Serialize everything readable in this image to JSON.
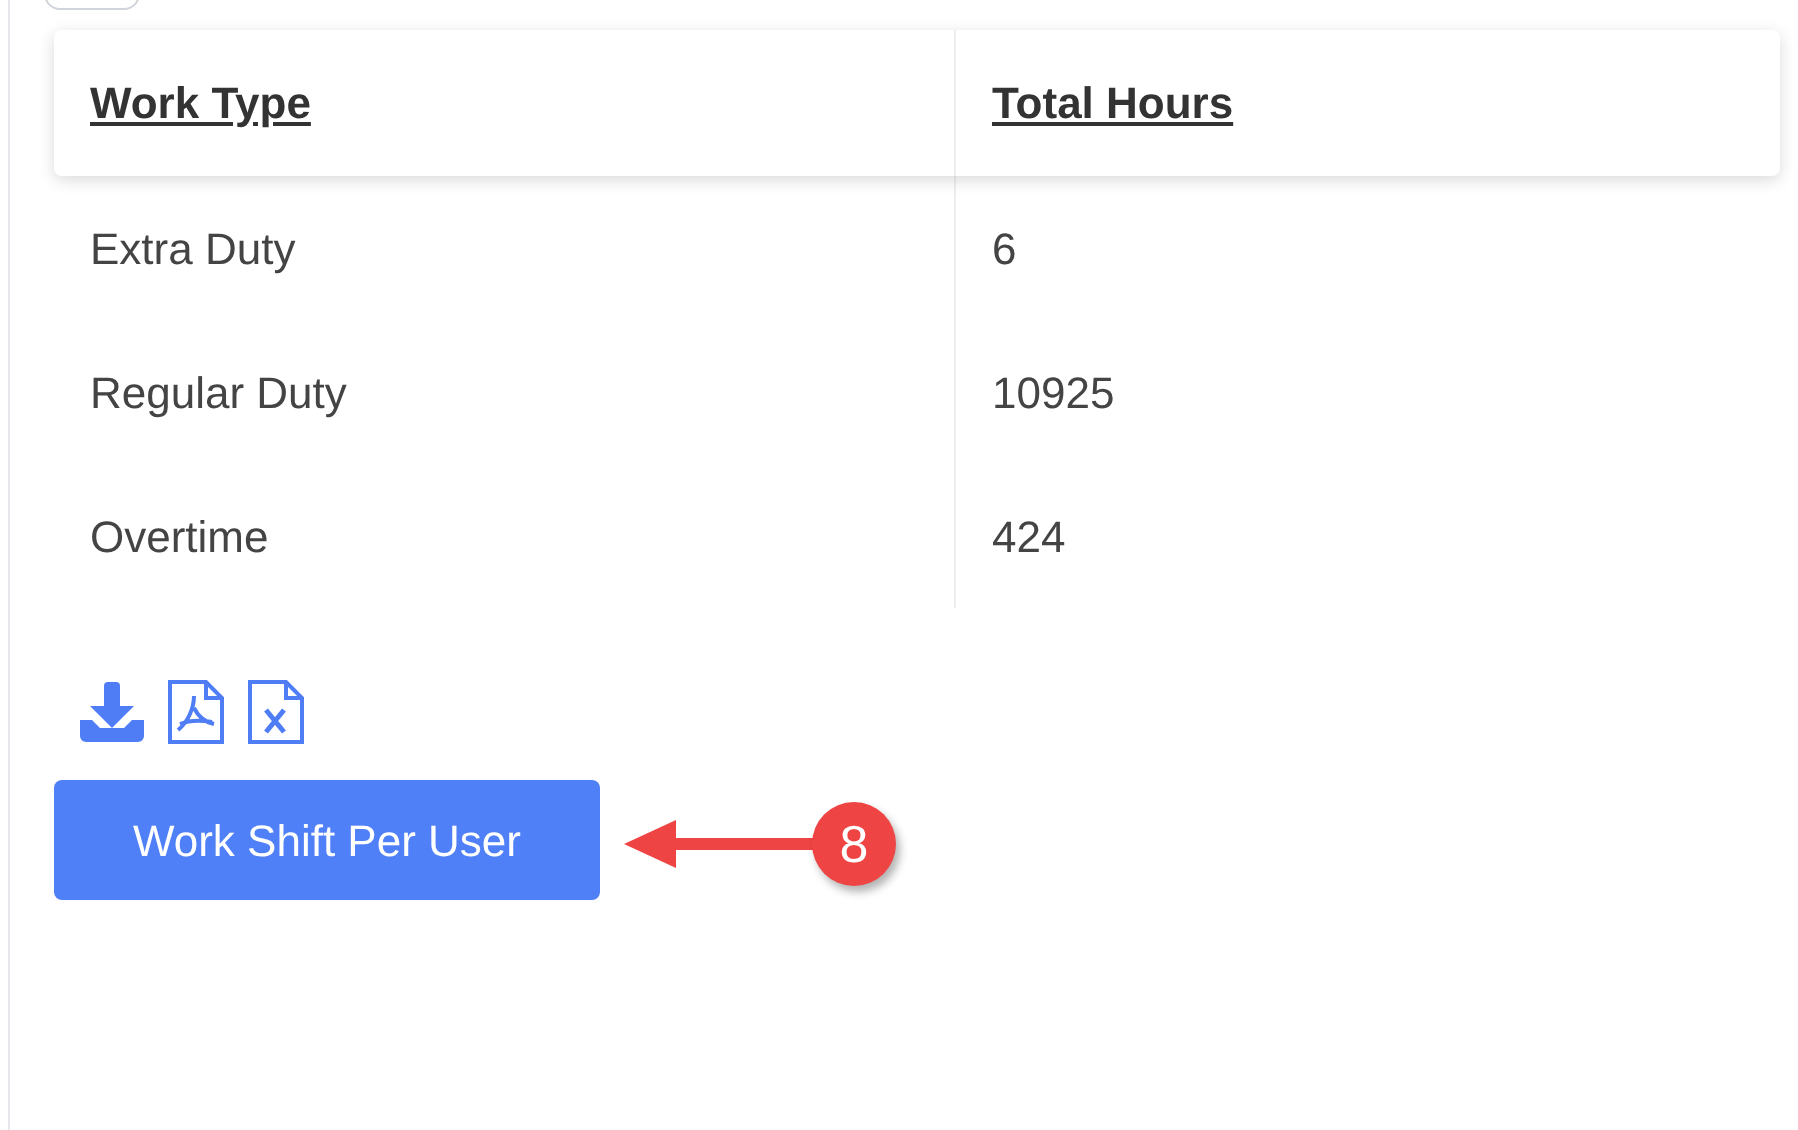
{
  "table": {
    "columns": [
      "Work Type",
      "Total Hours"
    ],
    "rows": [
      [
        "Extra Duty",
        "6"
      ],
      [
        "Regular Duty",
        "10925"
      ],
      [
        "Overtime",
        "424"
      ]
    ]
  },
  "button": {
    "label": "Work Shift Per User"
  },
  "callout": {
    "number": "8"
  }
}
